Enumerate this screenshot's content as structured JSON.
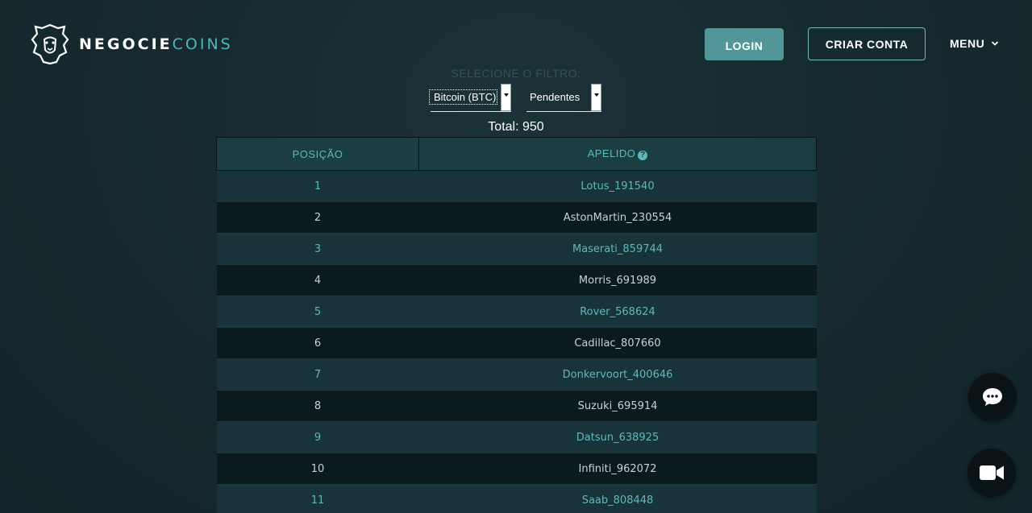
{
  "brand": {
    "name_part1": "NEGOCIE",
    "name_part2": "COINS",
    "accent": "#4fb6bd",
    "logo_icon": "lion-icon"
  },
  "header": {
    "login_label": "LOGIN",
    "create_account_label": "CRIAR CONTA",
    "menu_label": "MENU"
  },
  "filter": {
    "label": "SELECIONE O FILTRO:",
    "coin_selected": "Bitcoin (BTC)",
    "status_selected": "Pendentes"
  },
  "total_text": "Total: 950",
  "table": {
    "columns": [
      "POSIÇÃO",
      "APELIDO"
    ],
    "rows": [
      {
        "pos": "1",
        "nick": "Lotus_191540"
      },
      {
        "pos": "2",
        "nick": "AstonMartin_230554"
      },
      {
        "pos": "3",
        "nick": "Maserati_859744"
      },
      {
        "pos": "4",
        "nick": "Morris_691989"
      },
      {
        "pos": "5",
        "nick": "Rover_568624"
      },
      {
        "pos": "6",
        "nick": "Cadillac_807660"
      },
      {
        "pos": "7",
        "nick": "Donkervoort_400646"
      },
      {
        "pos": "8",
        "nick": "Suzuki_695914"
      },
      {
        "pos": "9",
        "nick": "Datsun_638925"
      },
      {
        "pos": "10",
        "nick": "Infiniti_962072"
      },
      {
        "pos": "11",
        "nick": "Saab_808448"
      }
    ]
  },
  "floating": {
    "chat_icon": "chat-bubble-icon",
    "video_icon": "video-camera-icon"
  }
}
